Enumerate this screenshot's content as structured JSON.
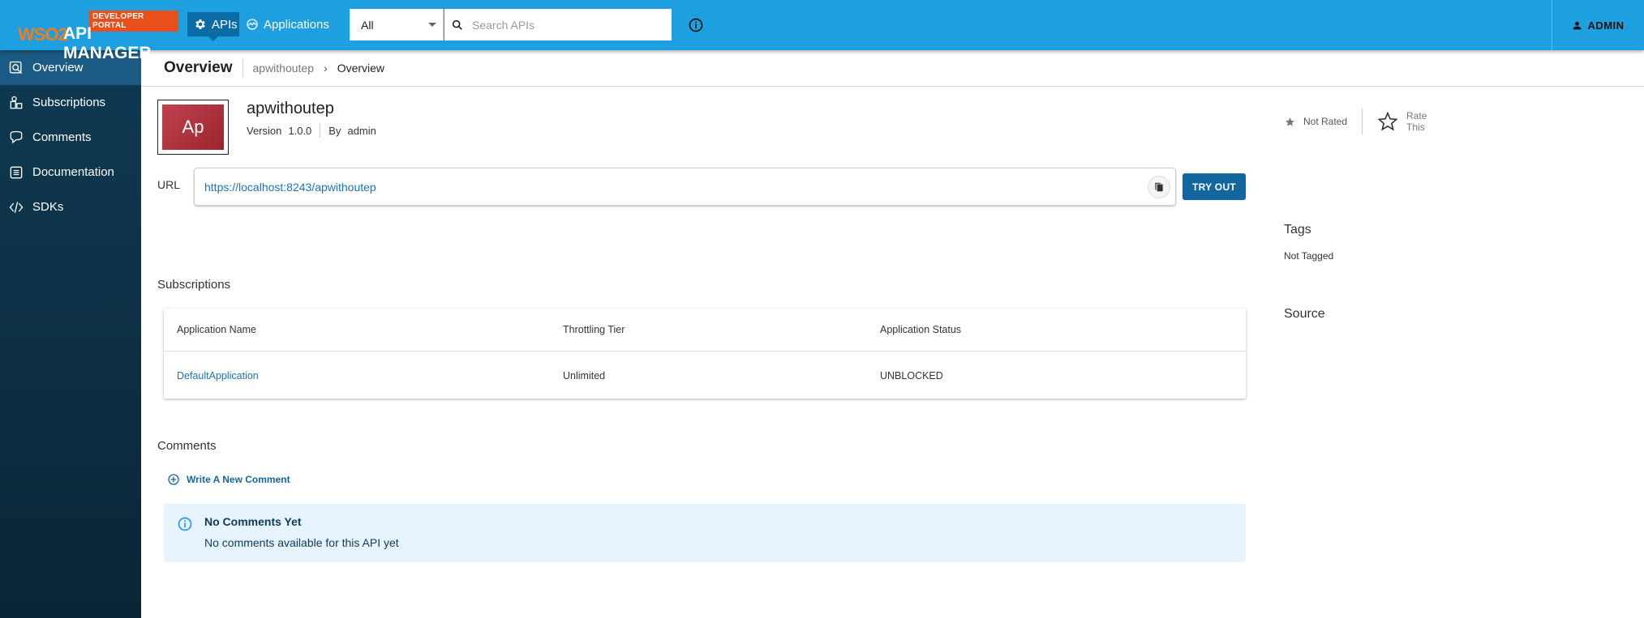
{
  "topbar": {
    "badge": "DEVELOPER PORTAL",
    "logo_wso2": "WSO2",
    "logo_product": "API MANAGER",
    "nav": [
      {
        "label": "APIs",
        "icon": "gear-icon",
        "active": true
      },
      {
        "label": "Applications",
        "icon": "applications-icon",
        "active": false
      }
    ],
    "search_scope": "All",
    "search_placeholder": "Search APIs",
    "user": "ADMIN",
    "colors": {
      "bar": "#1d9fe0",
      "active_nav": "#0b6ca5",
      "badge": "#e84f1b"
    }
  },
  "sidebar": {
    "items": [
      {
        "label": "Overview",
        "icon": "overview-icon",
        "active": true
      },
      {
        "label": "Subscriptions",
        "icon": "subscriptions-icon",
        "active": false
      },
      {
        "label": "Comments",
        "icon": "comments-icon",
        "active": false
      },
      {
        "label": "Documentation",
        "icon": "documentation-icon",
        "active": false
      },
      {
        "label": "SDKs",
        "icon": "code-icon",
        "active": false
      }
    ]
  },
  "header": {
    "title": "Overview",
    "breadcrumb": [
      "apwithoutep",
      "Overview"
    ]
  },
  "api": {
    "thumb_text": "Ap",
    "name": "apwithoutep",
    "version_label": "Version",
    "version": "1.0.0",
    "by_label": "By",
    "author": "admin",
    "rating_status": "Not Rated",
    "rate_label_1": "Rate",
    "rate_label_2": "This",
    "url_label": "URL",
    "url": "https://localhost:8243/apwithoutep",
    "try_out": "TRY OUT"
  },
  "side_info": {
    "tags_title": "Tags",
    "tags_value": "Not Tagged",
    "source_title": "Source"
  },
  "subscriptions": {
    "title": "Subscriptions",
    "columns": [
      "Application Name",
      "Throttling Tier",
      "Application Status"
    ],
    "rows": [
      [
        "DefaultApplication",
        "Unlimited",
        "UNBLOCKED"
      ]
    ]
  },
  "comments": {
    "title": "Comments",
    "write_label": "Write A New Comment",
    "empty_title": "No Comments Yet",
    "empty_text": "No comments available for this API yet"
  }
}
